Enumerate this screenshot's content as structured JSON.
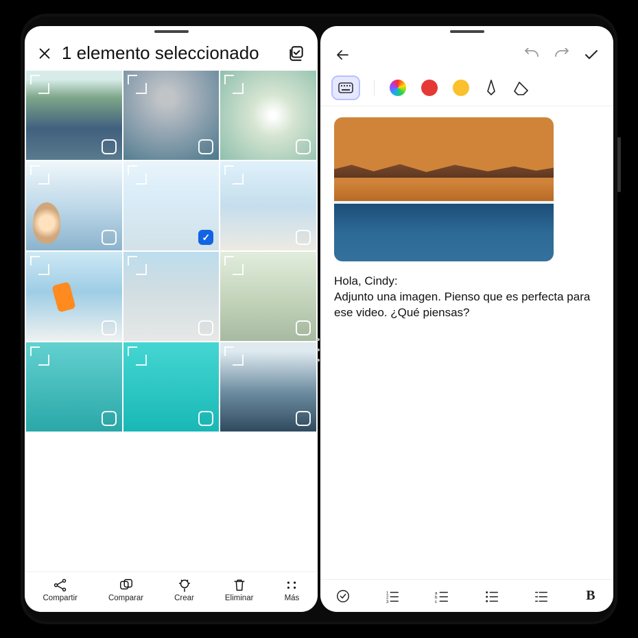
{
  "gallery": {
    "selection_title": "1 elemento seleccionado",
    "thumbs": [
      {
        "selected": false
      },
      {
        "selected": false
      },
      {
        "selected": false
      },
      {
        "selected": false
      },
      {
        "selected": true
      },
      {
        "selected": false
      },
      {
        "selected": false
      },
      {
        "selected": false
      },
      {
        "selected": false
      },
      {
        "selected": false
      },
      {
        "selected": false
      },
      {
        "selected": false
      }
    ],
    "footer": {
      "share": "Compartir",
      "compare": "Comparar",
      "create": "Crear",
      "delete": "Eliminar",
      "more": "Más"
    }
  },
  "notes": {
    "tools": {
      "keyboard": "keyboard",
      "colors": [
        "multi",
        "red",
        "yellow"
      ],
      "pen": "pen",
      "eraser": "eraser"
    },
    "note_text": "Hola, Cindy:\nAdjunto una imagen. Pienso que es perfecta para ese video. ¿Qué piensas?",
    "footer_icons": [
      "checklist",
      "numbered-list",
      "lettered-list",
      "bulleted-list",
      "list",
      "bold"
    ]
  }
}
